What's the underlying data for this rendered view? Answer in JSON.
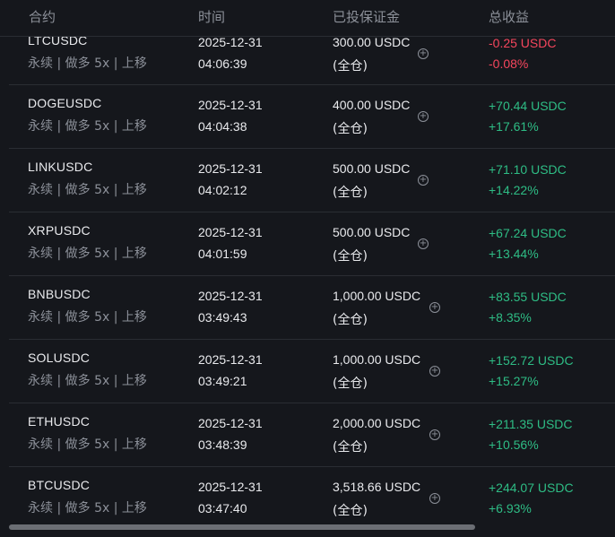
{
  "header": {
    "col_contract": "合约",
    "col_time": "时间",
    "col_margin": "已投保证金",
    "col_pnl": "总收益"
  },
  "colors": {
    "positive": "#2ebd85",
    "negative": "#f6465d",
    "muted": "#8c9099",
    "background": "#15171c"
  },
  "rows": [
    {
      "symbol": "LTCUSDC",
      "sub": "永续 | 做多 5x | 上移",
      "date": "2025-12-31",
      "time": "04:06:39",
      "margin": "300.00 USDC",
      "mode": "(全仓)",
      "pnl": "-0.25 USDC",
      "pnl_pct": "-0.08%",
      "sign": "neg"
    },
    {
      "symbol": "DOGEUSDC",
      "sub": "永续 | 做多 5x | 上移",
      "date": "2025-12-31",
      "time": "04:04:38",
      "margin": "400.00 USDC",
      "mode": "(全仓)",
      "pnl": "+70.44 USDC",
      "pnl_pct": "+17.61%",
      "sign": "pos"
    },
    {
      "symbol": "LINKUSDC",
      "sub": "永续 | 做多 5x | 上移",
      "date": "2025-12-31",
      "time": "04:02:12",
      "margin": "500.00 USDC",
      "mode": "(全仓)",
      "pnl": "+71.10 USDC",
      "pnl_pct": "+14.22%",
      "sign": "pos"
    },
    {
      "symbol": "XRPUSDC",
      "sub": "永续 | 做多 5x | 上移",
      "date": "2025-12-31",
      "time": "04:01:59",
      "margin": "500.00 USDC",
      "mode": "(全仓)",
      "pnl": "+67.24 USDC",
      "pnl_pct": "+13.44%",
      "sign": "pos"
    },
    {
      "symbol": "BNBUSDC",
      "sub": "永续 | 做多 5x | 上移",
      "date": "2025-12-31",
      "time": "03:49:43",
      "margin": "1,000.00 USDC",
      "mode": "(全仓)",
      "pnl": "+83.55 USDC",
      "pnl_pct": "+8.35%",
      "sign": "pos"
    },
    {
      "symbol": "SOLUSDC",
      "sub": "永续 | 做多 5x | 上移",
      "date": "2025-12-31",
      "time": "03:49:21",
      "margin": "1,000.00 USDC",
      "mode": "(全仓)",
      "pnl": "+152.72 USDC",
      "pnl_pct": "+15.27%",
      "sign": "pos"
    },
    {
      "symbol": "ETHUSDC",
      "sub": "永续 | 做多 5x | 上移",
      "date": "2025-12-31",
      "time": "03:48:39",
      "margin": "2,000.00 USDC",
      "mode": "(全仓)",
      "pnl": "+211.35 USDC",
      "pnl_pct": "+10.56%",
      "sign": "pos"
    },
    {
      "symbol": "BTCUSDC",
      "sub": "永续 | 做多 5x | 上移",
      "date": "2025-12-31",
      "time": "03:47:40",
      "margin": "3,518.66 USDC",
      "mode": "(全仓)",
      "pnl": "+244.07 USDC",
      "pnl_pct": "+6.93%",
      "sign": "pos"
    }
  ],
  "icons": {
    "margin_add": "plus-circle-icon"
  }
}
